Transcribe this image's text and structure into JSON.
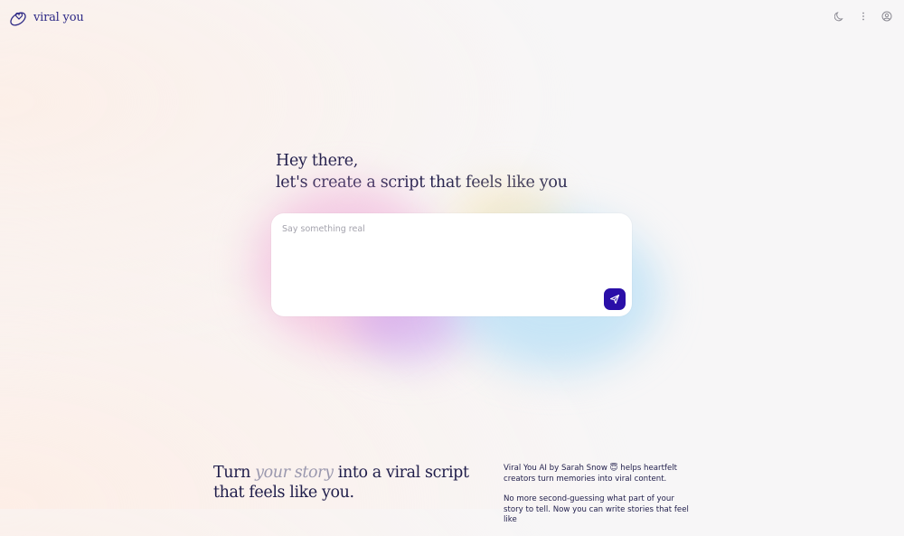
{
  "header": {
    "logo_text": "viral you",
    "icons": [
      "moon-icon",
      "more-vertical-icon",
      "account-icon"
    ]
  },
  "hero": {
    "line1": "Hey there,",
    "line2": "let's create a script that feels like you"
  },
  "prompt": {
    "placeholder": "Say something real",
    "send_icon": "send-icon"
  },
  "info": {
    "headline_part1": "Turn ",
    "headline_em": "your story",
    "headline_part2": " into a viral script",
    "headline_line2": "that feels like you.",
    "para1": "Viral You AI by Sarah Snow 😇 helps heartfelt creators turn memories into viral content.",
    "para2": "No more second-guessing what part of your story to tell. Now you can write stories that feel like"
  },
  "colors": {
    "accent": "#2a0fa8",
    "text": "#1f1d4a",
    "logo": "#2e2a86"
  }
}
